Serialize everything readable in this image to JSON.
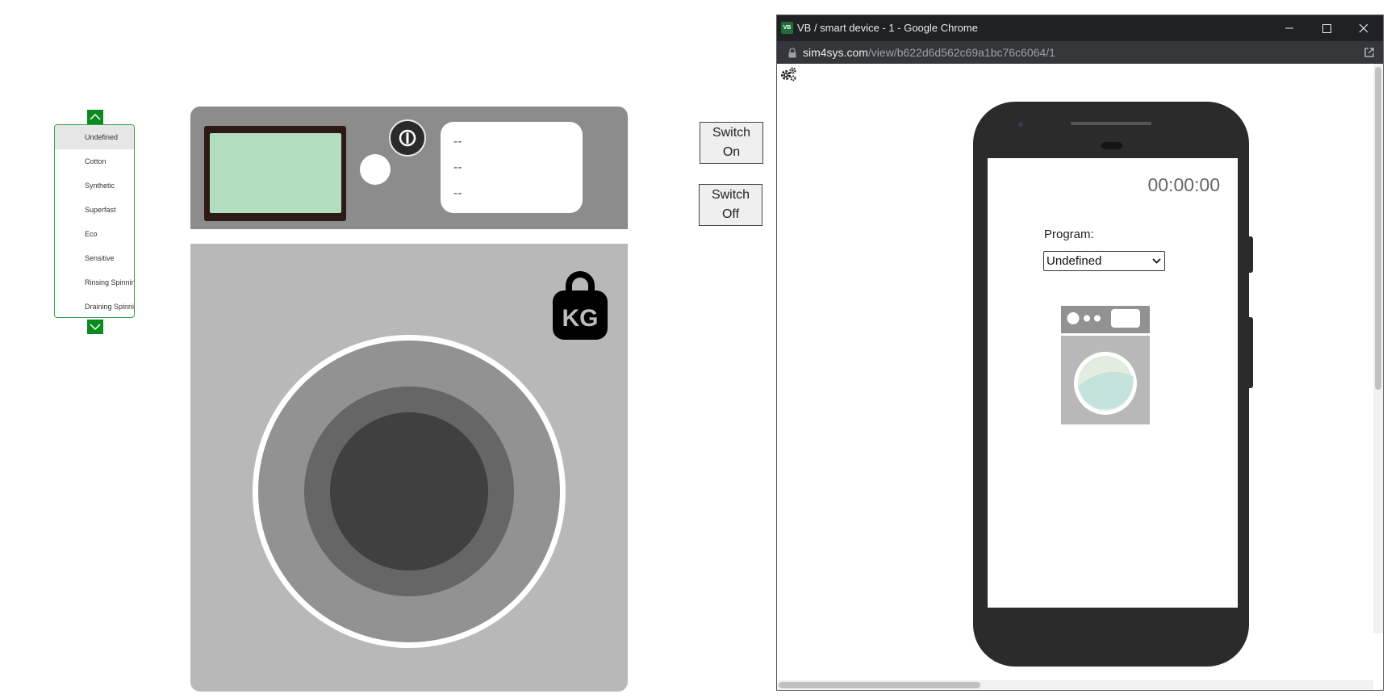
{
  "program_list": {
    "items": [
      "Undefined",
      "Cotton",
      "Synthetic",
      "Superfast",
      "Eco",
      "Sensitive",
      "Rinsing Spinning",
      "Draining Spinning"
    ],
    "selected": "Undefined"
  },
  "washer": {
    "info_lines": [
      "--",
      "--",
      "--"
    ],
    "weight_label": "KG"
  },
  "buttons": {
    "switch_on": [
      "Switch",
      "On"
    ],
    "switch_off": [
      "Switch",
      "Off"
    ]
  },
  "chrome": {
    "favicon_text": "VB",
    "title": "VB / smart device - 1 - Google Chrome",
    "url_host": "sim4sys.com",
    "url_path": "/view/b622d6d562c69a1bc76c6064/1"
  },
  "phone": {
    "timer": "00:00:00",
    "program_label": "Program:",
    "program_value": "Undefined"
  },
  "colors": {
    "accent_green": "#0a8a1f",
    "screen_green": "#b2ddbf",
    "washer_dark": "#8c8c8c",
    "washer_body": "#b8b8b8"
  }
}
